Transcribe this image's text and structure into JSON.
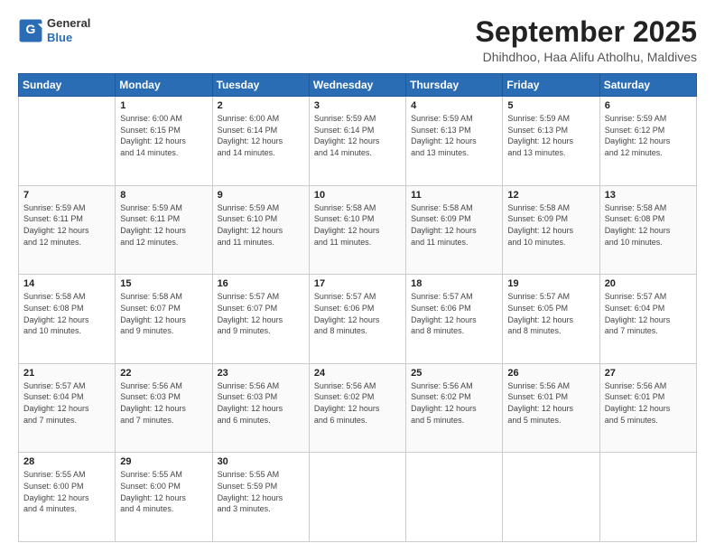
{
  "logo": {
    "line1": "General",
    "line2": "Blue"
  },
  "header": {
    "month": "September 2025",
    "location": "Dhihdhoo, Haa Alifu Atholhu, Maldives"
  },
  "days_of_week": [
    "Sunday",
    "Monday",
    "Tuesday",
    "Wednesday",
    "Thursday",
    "Friday",
    "Saturday"
  ],
  "weeks": [
    [
      {
        "day": "",
        "info": ""
      },
      {
        "day": "1",
        "info": "Sunrise: 6:00 AM\nSunset: 6:15 PM\nDaylight: 12 hours\nand 14 minutes."
      },
      {
        "day": "2",
        "info": "Sunrise: 6:00 AM\nSunset: 6:14 PM\nDaylight: 12 hours\nand 14 minutes."
      },
      {
        "day": "3",
        "info": "Sunrise: 5:59 AM\nSunset: 6:14 PM\nDaylight: 12 hours\nand 14 minutes."
      },
      {
        "day": "4",
        "info": "Sunrise: 5:59 AM\nSunset: 6:13 PM\nDaylight: 12 hours\nand 13 minutes."
      },
      {
        "day": "5",
        "info": "Sunrise: 5:59 AM\nSunset: 6:13 PM\nDaylight: 12 hours\nand 13 minutes."
      },
      {
        "day": "6",
        "info": "Sunrise: 5:59 AM\nSunset: 6:12 PM\nDaylight: 12 hours\nand 12 minutes."
      }
    ],
    [
      {
        "day": "7",
        "info": "Sunrise: 5:59 AM\nSunset: 6:11 PM\nDaylight: 12 hours\nand 12 minutes."
      },
      {
        "day": "8",
        "info": "Sunrise: 5:59 AM\nSunset: 6:11 PM\nDaylight: 12 hours\nand 12 minutes."
      },
      {
        "day": "9",
        "info": "Sunrise: 5:59 AM\nSunset: 6:10 PM\nDaylight: 12 hours\nand 11 minutes."
      },
      {
        "day": "10",
        "info": "Sunrise: 5:58 AM\nSunset: 6:10 PM\nDaylight: 12 hours\nand 11 minutes."
      },
      {
        "day": "11",
        "info": "Sunrise: 5:58 AM\nSunset: 6:09 PM\nDaylight: 12 hours\nand 11 minutes."
      },
      {
        "day": "12",
        "info": "Sunrise: 5:58 AM\nSunset: 6:09 PM\nDaylight: 12 hours\nand 10 minutes."
      },
      {
        "day": "13",
        "info": "Sunrise: 5:58 AM\nSunset: 6:08 PM\nDaylight: 12 hours\nand 10 minutes."
      }
    ],
    [
      {
        "day": "14",
        "info": "Sunrise: 5:58 AM\nSunset: 6:08 PM\nDaylight: 12 hours\nand 10 minutes."
      },
      {
        "day": "15",
        "info": "Sunrise: 5:58 AM\nSunset: 6:07 PM\nDaylight: 12 hours\nand 9 minutes."
      },
      {
        "day": "16",
        "info": "Sunrise: 5:57 AM\nSunset: 6:07 PM\nDaylight: 12 hours\nand 9 minutes."
      },
      {
        "day": "17",
        "info": "Sunrise: 5:57 AM\nSunset: 6:06 PM\nDaylight: 12 hours\nand 8 minutes."
      },
      {
        "day": "18",
        "info": "Sunrise: 5:57 AM\nSunset: 6:06 PM\nDaylight: 12 hours\nand 8 minutes."
      },
      {
        "day": "19",
        "info": "Sunrise: 5:57 AM\nSunset: 6:05 PM\nDaylight: 12 hours\nand 8 minutes."
      },
      {
        "day": "20",
        "info": "Sunrise: 5:57 AM\nSunset: 6:04 PM\nDaylight: 12 hours\nand 7 minutes."
      }
    ],
    [
      {
        "day": "21",
        "info": "Sunrise: 5:57 AM\nSunset: 6:04 PM\nDaylight: 12 hours\nand 7 minutes."
      },
      {
        "day": "22",
        "info": "Sunrise: 5:56 AM\nSunset: 6:03 PM\nDaylight: 12 hours\nand 7 minutes."
      },
      {
        "day": "23",
        "info": "Sunrise: 5:56 AM\nSunset: 6:03 PM\nDaylight: 12 hours\nand 6 minutes."
      },
      {
        "day": "24",
        "info": "Sunrise: 5:56 AM\nSunset: 6:02 PM\nDaylight: 12 hours\nand 6 minutes."
      },
      {
        "day": "25",
        "info": "Sunrise: 5:56 AM\nSunset: 6:02 PM\nDaylight: 12 hours\nand 5 minutes."
      },
      {
        "day": "26",
        "info": "Sunrise: 5:56 AM\nSunset: 6:01 PM\nDaylight: 12 hours\nand 5 minutes."
      },
      {
        "day": "27",
        "info": "Sunrise: 5:56 AM\nSunset: 6:01 PM\nDaylight: 12 hours\nand 5 minutes."
      }
    ],
    [
      {
        "day": "28",
        "info": "Sunrise: 5:55 AM\nSunset: 6:00 PM\nDaylight: 12 hours\nand 4 minutes."
      },
      {
        "day": "29",
        "info": "Sunrise: 5:55 AM\nSunset: 6:00 PM\nDaylight: 12 hours\nand 4 minutes."
      },
      {
        "day": "30",
        "info": "Sunrise: 5:55 AM\nSunset: 5:59 PM\nDaylight: 12 hours\nand 3 minutes."
      },
      {
        "day": "",
        "info": ""
      },
      {
        "day": "",
        "info": ""
      },
      {
        "day": "",
        "info": ""
      },
      {
        "day": "",
        "info": ""
      }
    ]
  ]
}
